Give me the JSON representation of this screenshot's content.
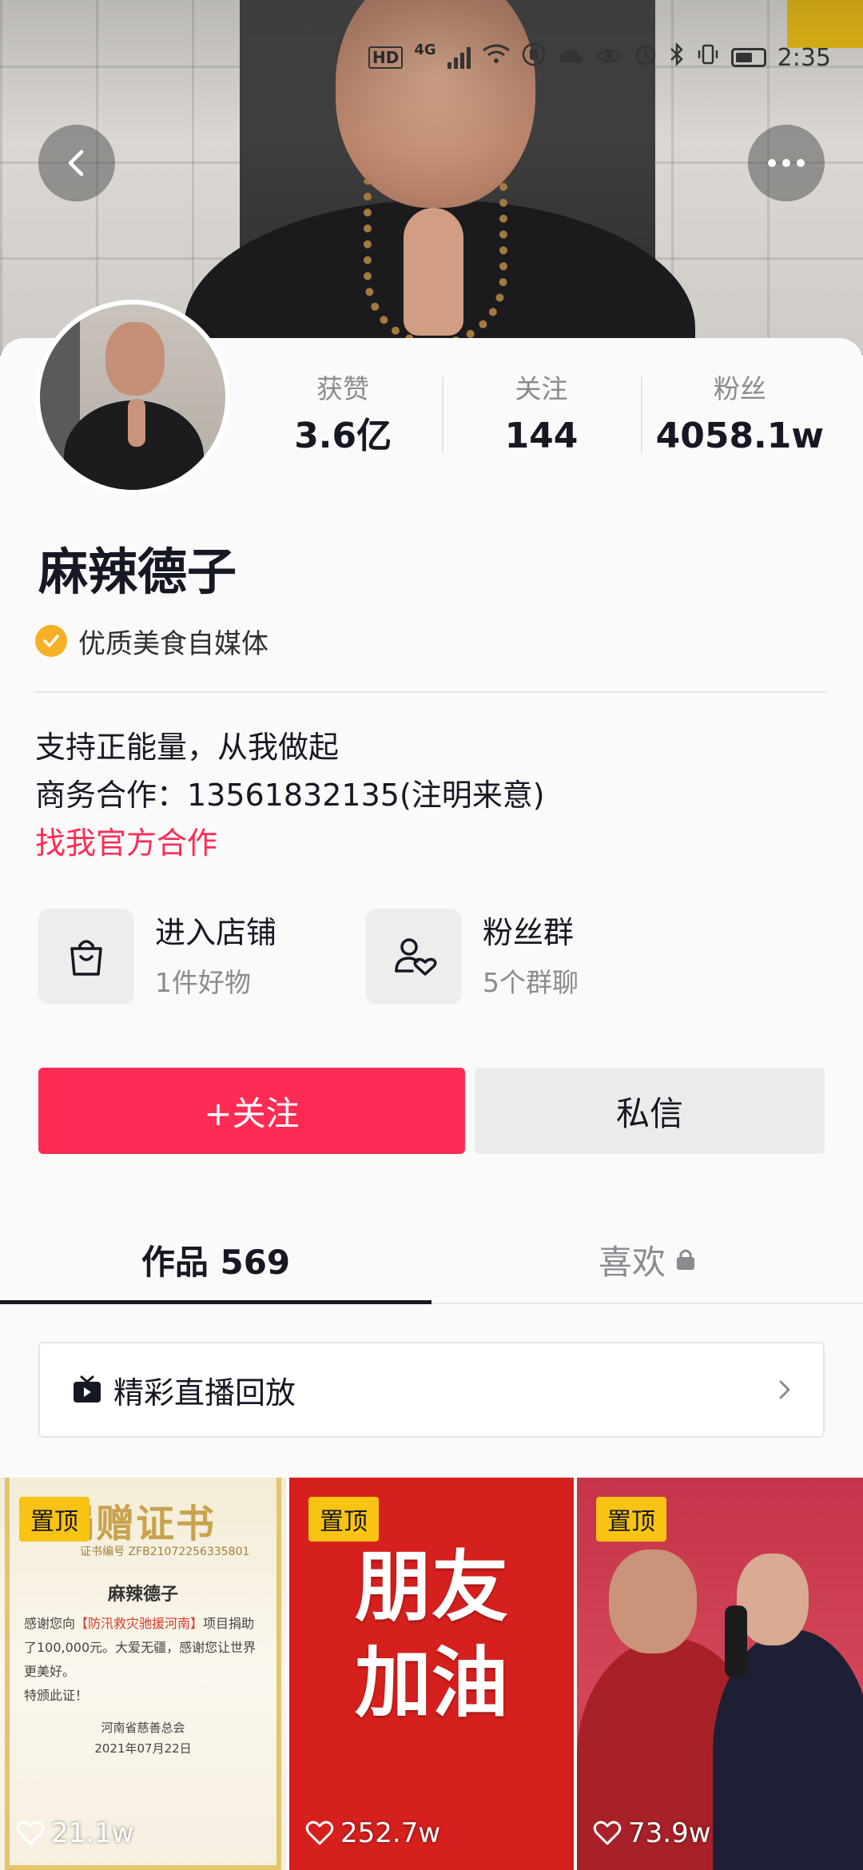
{
  "status_bar": {
    "hd": "HD",
    "network": "4G",
    "time": "2:35"
  },
  "profile": {
    "name": "麻辣德子",
    "verification": "优质美食自媒体",
    "stats": [
      {
        "label": "获赞",
        "value": "3.6亿"
      },
      {
        "label": "关注",
        "value": "144"
      },
      {
        "label": "粉丝",
        "value": "4058.1w"
      }
    ],
    "bio_lines": [
      "支持正能量，从我做起",
      "商务合作：13561832135(注明来意)"
    ],
    "bio_link": "找我官方合作"
  },
  "entries": {
    "shop": {
      "title": "进入店铺",
      "subtitle": "1件好物",
      "icon": "shopping-bag-icon"
    },
    "fan_group": {
      "title": "粉丝群",
      "subtitle": "5个群聊",
      "icon": "group-heart-icon"
    }
  },
  "actions": {
    "follow": "+关注",
    "message": "私信"
  },
  "tabs": {
    "works": "作品 569",
    "likes": "喜欢"
  },
  "live_replay": {
    "label": "精彩直播回放"
  },
  "videos": [
    {
      "pinned": "置顶",
      "likes": "21.1w",
      "cert": {
        "title": "捐赠证书",
        "number": "证书编号 ZFB21072256335801",
        "name": "麻辣德子",
        "body_prefix": "感谢您向",
        "body_project": "【防汛救灾驰援河南】",
        "body_suffix": "项目捐助了100,000元。大爱无疆，感谢您让世界更美好。",
        "special": "特颁此证！",
        "org": "河南省慈善总会",
        "date": "2021年07月22日"
      }
    },
    {
      "pinned": "置顶",
      "likes": "252.7w",
      "line1": "朋友",
      "line2": "加油"
    },
    {
      "pinned": "置顶",
      "likes": "73.9w"
    }
  ],
  "colors": {
    "accent": "#fe2c55",
    "pin": "#f8c313",
    "verify": "#f5b026"
  }
}
